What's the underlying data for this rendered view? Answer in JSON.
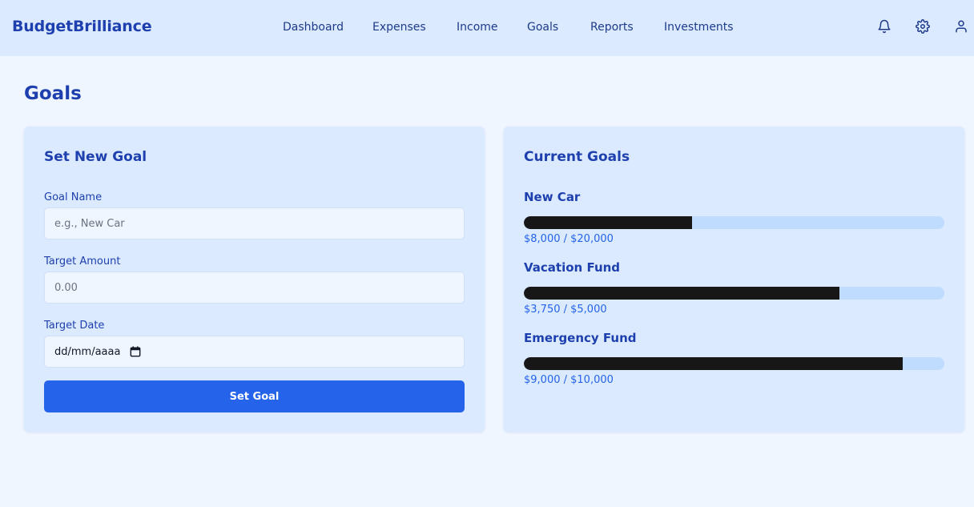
{
  "app": {
    "brand": "BudgetBrilliance"
  },
  "nav": {
    "items": [
      {
        "label": "Dashboard"
      },
      {
        "label": "Expenses"
      },
      {
        "label": "Income"
      },
      {
        "label": "Goals"
      },
      {
        "label": "Reports"
      },
      {
        "label": "Investments"
      }
    ]
  },
  "header_icons": [
    "bell-icon",
    "gear-icon",
    "user-icon"
  ],
  "page": {
    "title": "Goals"
  },
  "new_goal": {
    "title": "Set New Goal",
    "goal_name_label": "Goal Name",
    "goal_name_placeholder": "e.g., New Car",
    "goal_name_value": "",
    "target_amount_label": "Target Amount",
    "target_amount_placeholder": "0.00",
    "target_amount_value": "",
    "target_date_label": "Target Date",
    "target_date_display": "dd/mm/aaaa",
    "submit_label": "Set Goal"
  },
  "current_goals": {
    "title": "Current Goals",
    "items": [
      {
        "name": "New Car",
        "amount_text": "$8,000 / $20,000",
        "progress": 0.4
      },
      {
        "name": "Vacation Fund",
        "amount_text": "$3,750 / $5,000",
        "progress": 0.75
      },
      {
        "name": "Emergency Fund",
        "amount_text": "$9,000 / $10,000",
        "progress": 0.9
      }
    ]
  },
  "colors": {
    "accent": "#2563eb",
    "brand_text": "#1e40af",
    "header_bg": "#dbeafe",
    "page_bg": "#eff6ff",
    "progress_fill": "#171717",
    "progress_track": "#bfdbfe"
  }
}
